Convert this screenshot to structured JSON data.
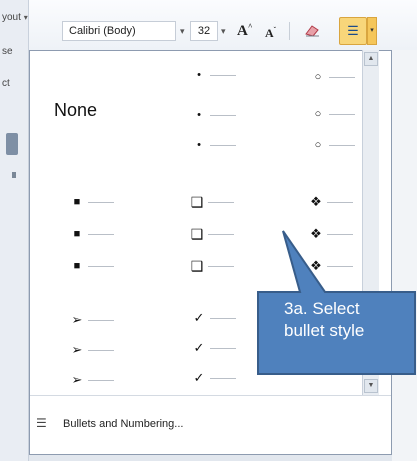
{
  "ribbon": {
    "edge_top": "yout",
    "edge_top_arrow": "▾",
    "edge_mid1": "se",
    "edge_mid2": "ct",
    "font_name": "Calibri (Body)",
    "font_size": "32",
    "grow_font": "A",
    "grow_superscript": "^",
    "shrink_font": "A",
    "shrink_superscript": "ˇ",
    "clear_formatting_icon": "eraser-icon",
    "bullets_icon": "bullets-icon",
    "bullets_glyph": "☰",
    "dropdown_glyph": "▾"
  },
  "gallery": {
    "none_label": "None",
    "rows": [
      {
        "marks": [
          "•",
          "•",
          "•"
        ],
        "kind": "dot"
      },
      {
        "marks": [
          "○",
          "○",
          "○"
        ],
        "kind": "circle"
      }
    ],
    "col1": {
      "glyph": "■",
      "count": 3
    },
    "col2": {
      "glyph": "❑",
      "count": 3
    },
    "col3": {
      "glyph": "❖",
      "count": 3
    },
    "col4": {
      "glyph": "➢",
      "count": 3
    },
    "col5": {
      "glyph": "✓",
      "count": 3
    },
    "dot_glyph": "•",
    "circle_glyph": "○",
    "scroll_up_glyph": "▲",
    "scroll_down_glyph": "▼"
  },
  "footer": {
    "bullets_and_numbering_label": "Bullets and Numbering...",
    "bullets_and_numbering_icon": "list-icon",
    "icon_glyph": "☰"
  },
  "callout": {
    "line1": "3a. Select",
    "line2": "bullet style",
    "fill_color": "#4f81bd",
    "border_color": "#385d8a"
  }
}
